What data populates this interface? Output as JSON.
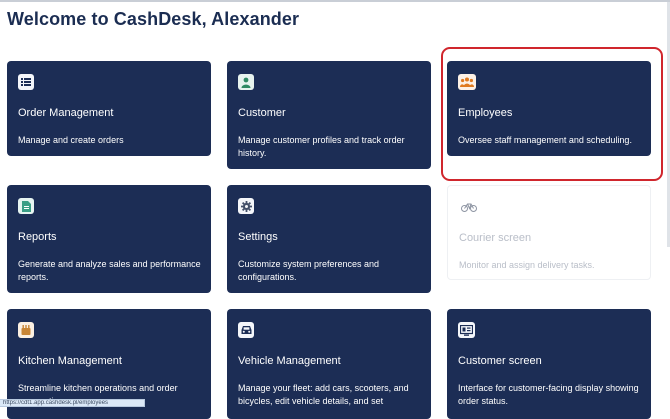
{
  "header": {
    "title": "Welcome to CashDesk, Alexander"
  },
  "status_url": "https://cdt1.app.cashdesk.pl/employees",
  "accent_colors": {
    "card": "#1c2d55",
    "highlight": "#d0262d"
  },
  "cards": [
    {
      "title": "Order Management",
      "desc": "Manage and create orders",
      "icon": "list-icon"
    },
    {
      "title": "Customer",
      "desc": "Manage customer profiles and track order history.",
      "icon": "person-icon"
    },
    {
      "title": "Employees",
      "desc": "Oversee staff management and scheduling.",
      "icon": "team-icon",
      "highlighted": true
    },
    {
      "title": "Reports",
      "desc": "Generate and analyze sales and performance reports.",
      "icon": "document-icon"
    },
    {
      "title": "Settings",
      "desc": "Customize system preferences and configurations.",
      "icon": "gear-icon"
    },
    {
      "title": "Courier screen",
      "desc": "Monitor and assign delivery tasks.",
      "icon": "bicycle-icon",
      "disabled": true
    },
    {
      "title": "Kitchen Management",
      "desc": "Streamline kitchen operations and order preparation.",
      "icon": "kitchen-icon"
    },
    {
      "title": "Vehicle Management",
      "desc": "Manage your fleet: add cars, scooters, and bicycles, edit vehicle details, and set",
      "icon": "car-icon"
    },
    {
      "title": "Customer screen",
      "desc": "Interface for customer-facing display showing order status.",
      "icon": "display-icon"
    }
  ]
}
